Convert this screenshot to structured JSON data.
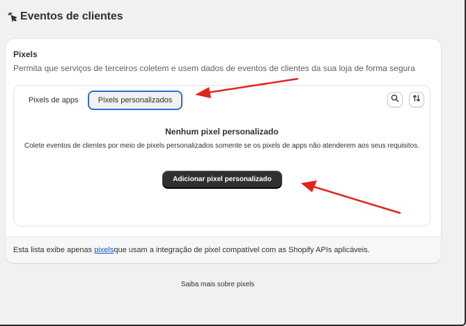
{
  "page": {
    "title": "Eventos de clientes",
    "icon": "customer-events-icon"
  },
  "card": {
    "title": "Pixels",
    "description": "Permita que serviços de terceiros coletem e usem dados de eventos de clientes da sua loja de forma segura",
    "tabs": [
      {
        "label": "Pixels de apps",
        "selected": false
      },
      {
        "label": "Pixels personalizados",
        "selected": true
      }
    ],
    "tools": {
      "search_icon": "search-icon",
      "sort_icon": "sort-icon"
    },
    "empty_state": {
      "title": "Nenhum pixel personalizado",
      "description": "Colete eventos de clientes por meio de pixels personalizados somente se os pixels de apps não atenderem aos seus requisitos.",
      "button_label": "Adicionar pixel personalizado"
    },
    "footer": {
      "prefix": "Esta lista exibe apenas ",
      "link": "pixels",
      "suffix": " que usam a integração de pixel compatível com as Shopify APIs aplicáveis."
    }
  },
  "learn_more": "Saiba mais sobre pixels",
  "colors": {
    "accent": "#2c6ecb",
    "link": "#005bd3",
    "primary_button": "#303030",
    "annotation_arrow": "#e3241b"
  }
}
